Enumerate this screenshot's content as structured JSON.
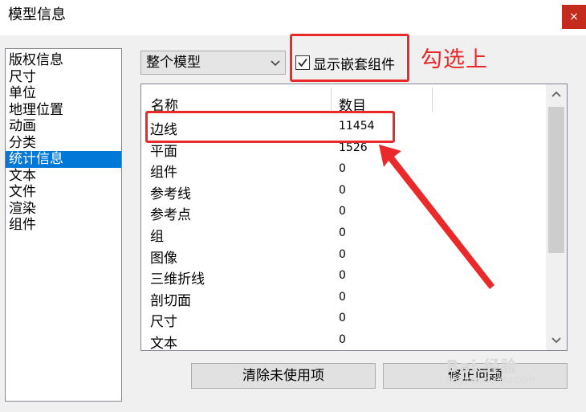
{
  "window": {
    "title": "模型信息",
    "close_symbol": "×"
  },
  "sidebar": {
    "items": [
      {
        "label": "版权信息"
      },
      {
        "label": "尺寸"
      },
      {
        "label": "单位"
      },
      {
        "label": "地理位置"
      },
      {
        "label": "动画"
      },
      {
        "label": "分类"
      },
      {
        "label": "统计信息",
        "selected": true
      },
      {
        "label": "文本"
      },
      {
        "label": "文件"
      },
      {
        "label": "渲染"
      },
      {
        "label": "组件"
      }
    ]
  },
  "scope": {
    "selected": "整个模型",
    "icon": "chevron-down-icon"
  },
  "nested": {
    "checked": true,
    "label": "显示嵌套组件"
  },
  "annotation": {
    "text": "勾选上",
    "color": "#ea2a2a"
  },
  "table": {
    "headers": {
      "name": "名称",
      "count": "数目"
    },
    "rows": [
      {
        "name": "边线",
        "count": "11454"
      },
      {
        "name": "平面",
        "count": "1526"
      },
      {
        "name": "组件",
        "count": "0"
      },
      {
        "name": "参考线",
        "count": "0"
      },
      {
        "name": "参考点",
        "count": "0"
      },
      {
        "name": "组",
        "count": "0"
      },
      {
        "name": "图像",
        "count": "0"
      },
      {
        "name": "三维折线",
        "count": "0"
      },
      {
        "name": "剖切面",
        "count": "0"
      },
      {
        "name": "尺寸",
        "count": "0"
      },
      {
        "name": "文本",
        "count": "0"
      }
    ]
  },
  "buttons": {
    "purge": "清除未使用项",
    "fix": "修正问题"
  },
  "watermark": {
    "text": "Bai 经验",
    "sub": "jingyan.baidu.com"
  },
  "colors": {
    "selection": "#0078d7",
    "close": "#c42b1c",
    "annotation": "#ea2a2a"
  }
}
